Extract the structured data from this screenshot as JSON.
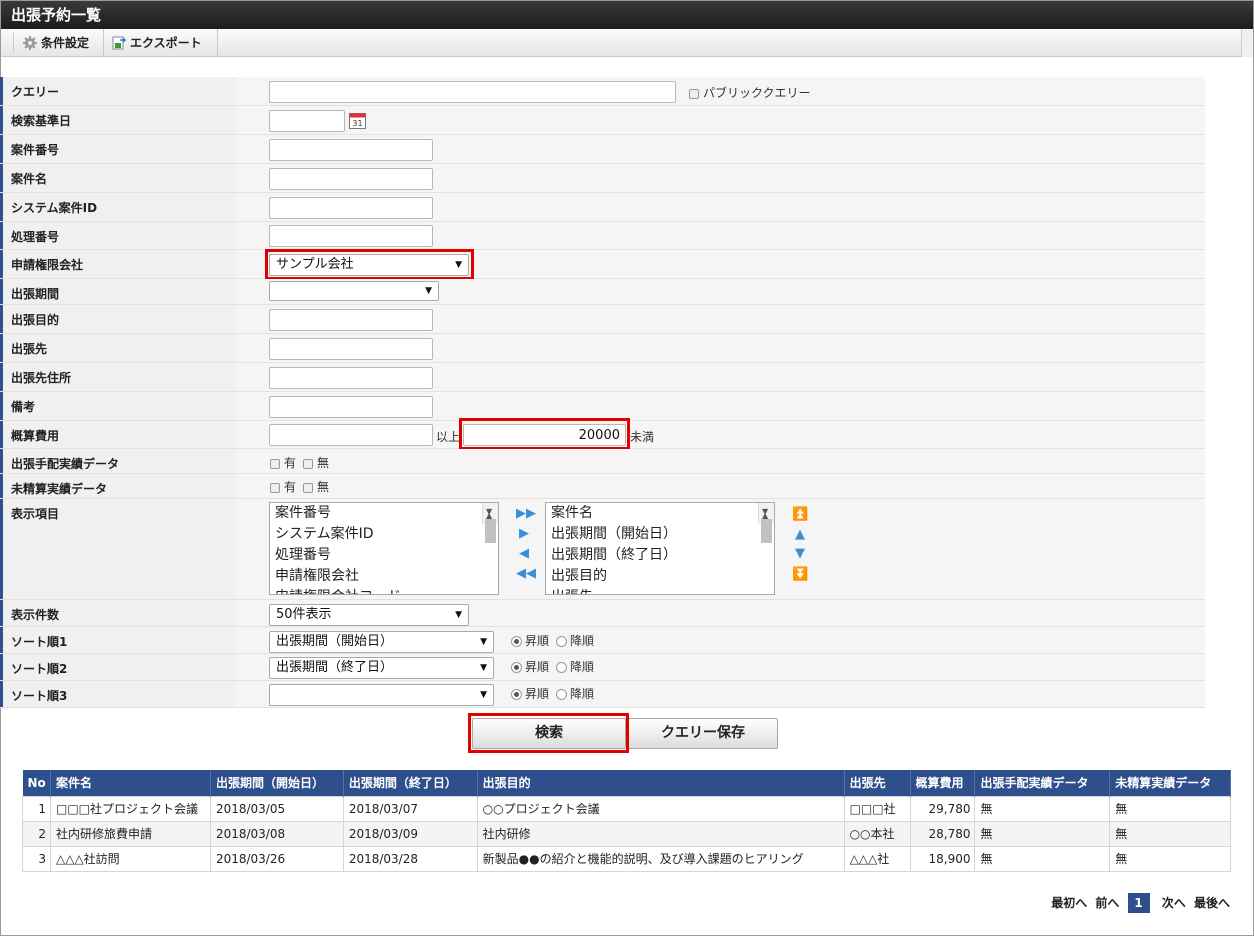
{
  "title": "出張予約一覧",
  "toolbar": {
    "condition": "条件設定",
    "export": "エクスポート"
  },
  "labels": {
    "query": "クエリー",
    "base_date": "検索基準日",
    "matter_no": "案件番号",
    "matter_name": "案件名",
    "system_id": "システム案件ID",
    "process_no": "処理番号",
    "company": "申請権限会社",
    "period": "出張期間",
    "purpose": "出張目的",
    "destination": "出張先",
    "dest_address": "出張先住所",
    "note": "備考",
    "cost": "概算費用",
    "arrangement": "出張手配実績データ",
    "unsettled": "未精算実績データ",
    "display_items": "表示項目",
    "display_count": "表示件数",
    "sort1": "ソート順1",
    "sort2": "ソート順2",
    "sort3": "ソート順3"
  },
  "public_query": "パブリッククエリー",
  "company_value": "サンプル会社",
  "cost_to": "20000",
  "cost_ge": "以上",
  "cost_lt": "未満",
  "yes": "有",
  "no": "無",
  "available_items": [
    "案件番号",
    "システム案件ID",
    "処理番号",
    "申請権限会社",
    "申請権限会社コード"
  ],
  "selected_items": [
    "案件名",
    "出張期間（開始日）",
    "出張期間（終了日）",
    "出張目的",
    "出張先"
  ],
  "display_count_value": "50件表示",
  "sort1_value": "出張期間（開始日）",
  "sort2_value": "出張期間（終了日）",
  "asc": "昇順",
  "desc": "降順",
  "search_button": "検索",
  "save_query_button": "クエリー保存",
  "table": {
    "headers": [
      "No",
      "案件名",
      "出張期間（開始日）",
      "出張期間（終了日）",
      "出張目的",
      "出張先",
      "概算費用",
      "出張手配実績データ",
      "未精算実績データ"
    ],
    "rows": [
      [
        "1",
        "□□□社プロジェクト会議",
        "2018/03/05",
        "2018/03/07",
        "○○プロジェクト会議",
        "□□□社",
        "29,780",
        "無",
        "無"
      ],
      [
        "2",
        "社内研修旅費申請",
        "2018/03/08",
        "2018/03/09",
        "社内研修",
        "○○本社",
        "28,780",
        "無",
        "無"
      ],
      [
        "3",
        "△△△社訪問",
        "2018/03/26",
        "2018/03/28",
        "新製品●●の紹介と機能的説明、及び導入課題のヒアリング",
        "△△△社",
        "18,900",
        "無",
        "無"
      ]
    ]
  },
  "pager": {
    "first": "最初へ",
    "prev": "前へ",
    "current": "1",
    "next": "次へ",
    "last": "最後へ"
  }
}
